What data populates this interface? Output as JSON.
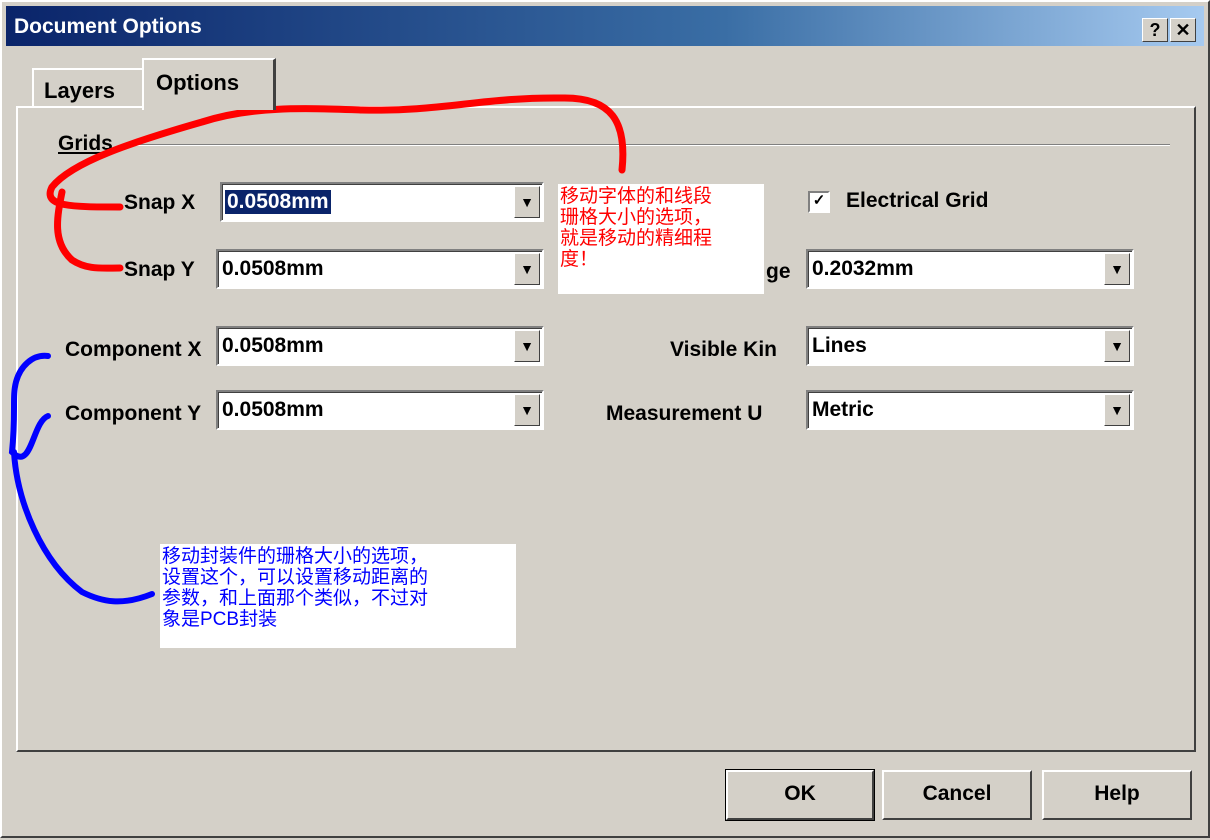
{
  "window": {
    "title": "Document Options",
    "help_glyph": "?",
    "close_glyph": "✕"
  },
  "tabs": [
    {
      "label": "Layers"
    },
    {
      "label": "Options"
    }
  ],
  "grids": {
    "group_label": "Grids",
    "snap_x": {
      "label": "Snap X",
      "value": "0.0508mm"
    },
    "snap_y": {
      "label": "Snap Y",
      "value": "0.0508mm"
    },
    "component_x": {
      "label": "Component X",
      "value": "0.0508mm"
    },
    "component_y": {
      "label": "Component Y",
      "value": "0.0508mm"
    },
    "electrical_grid": {
      "label": "Electrical Grid",
      "checked": true,
      "check_glyph": "✓"
    },
    "range": {
      "label": "ge",
      "value": "0.2032mm"
    },
    "visible_kind": {
      "label": "Visible Kin",
      "value": "Lines"
    },
    "measurement_unit": {
      "label": "Measurement U",
      "value": "Metric"
    }
  },
  "combo_arrow_glyph": "▼",
  "annotations": {
    "red_note": "移动字体的和线段\n珊格大小的选项，\n就是移动的精细程\n度！",
    "blue_note": "移动封装件的珊格大小的选项，\n设置这个，可以设置移动距离的\n参数，和上面那个类似，不过对\n象是PCB封装",
    "red_color": "#ff0000",
    "blue_color": "#0000ff"
  },
  "buttons": {
    "ok": "OK",
    "cancel": "Cancel",
    "help": "Help"
  }
}
